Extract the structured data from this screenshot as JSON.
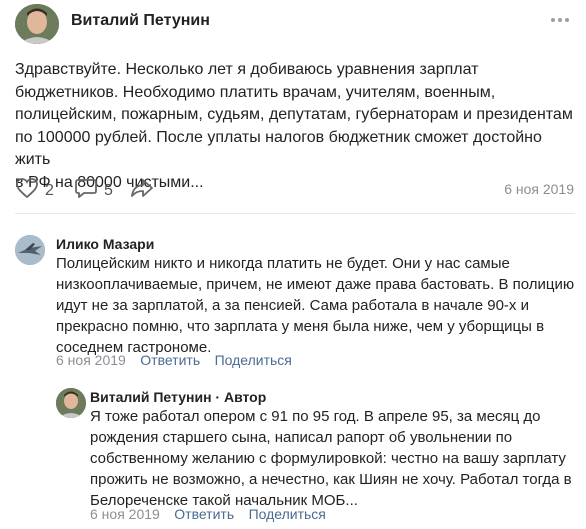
{
  "post": {
    "author": "Виталий Петунин",
    "lines": [
      "Здравствуйте. Несколько лет я добиваюсь уравнения зарплат",
      "бюджетников. Необходимо платить врачам, учителям, военным,",
      "полицейским, пожарным, судьям, депутатам, губернаторам и президентам",
      "по 100000 рублей. После уплаты налогов бюджетник сможет достойно жить",
      "в РФ на 80000 чистыми..."
    ],
    "likes": "2",
    "comments": "5",
    "date": "6 ноя 2019",
    "icons": [
      "heart-icon",
      "comment-icon",
      "share-icon",
      "more-icon"
    ]
  },
  "comment1": {
    "author": "Илико Мазари",
    "lines": [
      "Полицейским никто и никогда платить не будет. Они у нас самые",
      "низкооплачиваемые, причем, не имеют даже права бастовать. В полицию",
      "идут не за зарплатой, а за пенсией. Сама работала в начале 90-х и",
      "прекрасно помню, что зарплата у меня была ниже, чем у уборщицы в",
      "соседнем гастрономе."
    ],
    "date": "6 ноя 2019",
    "reply": "Ответить",
    "share": "Поделиться"
  },
  "comment2": {
    "author": "Виталий Петунин",
    "badge": "· Автор",
    "lines": [
      "Я тоже работал опером с 91 по 95 год. В апреле 95, за месяц до",
      "рождения старшего сына, написал рапорт об увольнении по",
      "собственному желанию с формулировкой: честно на вашу зарплату",
      "прожить не возможно, а нечестно, как Шиян не хочу. Работал тогда в",
      "Белореченске такой начальник МОБ..."
    ],
    "date": "6 ноя 2019",
    "reply": "Ответить",
    "share": "Поделиться"
  }
}
